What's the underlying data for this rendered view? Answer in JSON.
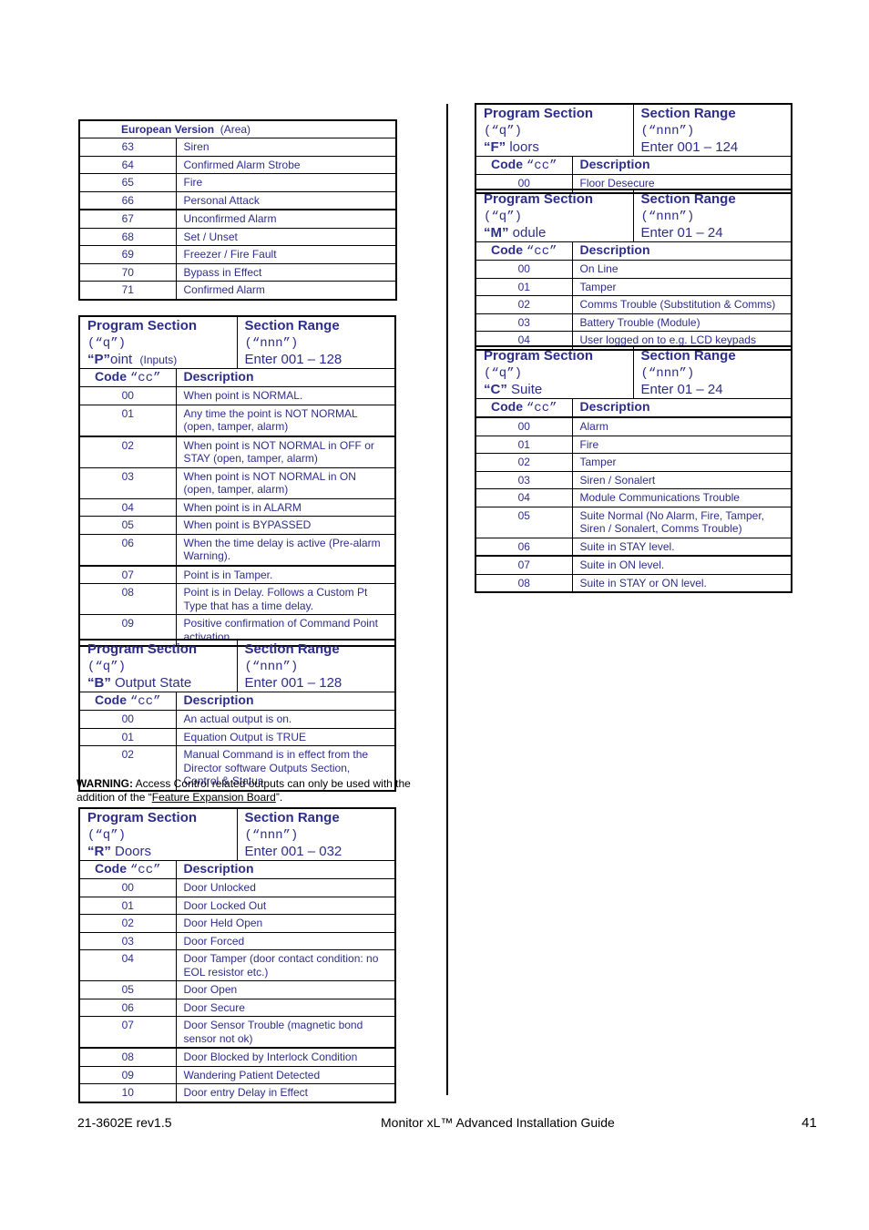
{
  "european": {
    "title_bold": "European Version",
    "title_rest": "(Area)",
    "rows": [
      {
        "code": "63",
        "desc": "Siren"
      },
      {
        "code": "64",
        "desc": "Confirmed Alarm Strobe"
      },
      {
        "code": "65",
        "desc": "Fire"
      },
      {
        "code": "66",
        "desc": "Personal Attack"
      },
      {
        "code": "67",
        "desc": "Unconfirmed Alarm"
      },
      {
        "code": "68",
        "desc": "Set / Unset"
      },
      {
        "code": "69",
        "desc": "Freezer / Fire Fault"
      },
      {
        "code": "70",
        "desc": "Bypass in Effect"
      },
      {
        "code": "71",
        "desc": "Confirmed Alarm"
      }
    ]
  },
  "common": {
    "program_section": "Program Section",
    "q_label": "(“q”)",
    "section_range": "Section Range",
    "nnn_label": "(“nnn”)",
    "code_label": "Code",
    "cc_label": "“cc”",
    "description_label": "Description"
  },
  "point": {
    "letter": "“P”",
    "name": "oint",
    "note": "(Inputs)",
    "range": "Enter 001 – 128",
    "rows": [
      {
        "code": "00",
        "desc": "When point is NORMAL."
      },
      {
        "code": "01",
        "desc": "Any time the point is NOT NORMAL (open, tamper, alarm)"
      },
      {
        "code": "02",
        "desc": "When point is NOT NORMAL in OFF or STAY (open, tamper, alarm)"
      },
      {
        "code": "03",
        "desc": "When point is NOT NORMAL in ON (open, tamper, alarm)"
      },
      {
        "code": "04",
        "desc": "When point is in ALARM"
      },
      {
        "code": "05",
        "desc": "When point is BYPASSED"
      },
      {
        "code": "06",
        "desc": "When the time delay is active (Pre-alarm Warning)."
      },
      {
        "code": "07",
        "desc": "Point is in Tamper."
      },
      {
        "code": "08",
        "desc": "Point is in Delay. Follows a Custom Pt Type that has a time delay."
      },
      {
        "code": "09",
        "desc": "Positive confirmation of Command Point activation."
      }
    ]
  },
  "output": {
    "letter": "“B”",
    "name": " Output State",
    "range": "Enter 001 – 128",
    "rows": [
      {
        "code": "00",
        "desc": "An actual output is on."
      },
      {
        "code": "01",
        "desc": "Equation Output is TRUE"
      },
      {
        "code": "02",
        "desc": "Manual Command is in effect from the Director software Outputs Section, Control & Status."
      }
    ]
  },
  "warning": {
    "label": "WARNING:",
    "text1": " Access Control related outputs can only be used with the addition of the “",
    "link": "Feature Expansion Board",
    "text2": "”."
  },
  "doors": {
    "letter": "“R”",
    "name": " Doors",
    "range": "Enter 001 – 032",
    "rows": [
      {
        "code": "00",
        "desc": "Door Unlocked"
      },
      {
        "code": "01",
        "desc": "Door Locked Out"
      },
      {
        "code": "02",
        "desc": "Door Held Open"
      },
      {
        "code": "03",
        "desc": "Door Forced"
      },
      {
        "code": "04",
        "desc": "Door Tamper (door contact condition: no EOL resistor etc.)"
      },
      {
        "code": "05",
        "desc": "Door Open"
      },
      {
        "code": "06",
        "desc": "Door Secure"
      },
      {
        "code": "07",
        "desc": "Door Sensor Trouble (magnetic bond sensor not ok)"
      },
      {
        "code": "08",
        "desc": "Door Blocked by Interlock Condition"
      },
      {
        "code": "09",
        "desc": "Wandering Patient Detected"
      },
      {
        "code": "10",
        "desc": "Door entry Delay in Effect"
      }
    ]
  },
  "floors": {
    "letter": "“F”",
    "name": " loors",
    "range": "Enter 001 – 124",
    "rows": [
      {
        "code": "00",
        "desc": "Floor Desecure"
      }
    ]
  },
  "module": {
    "letter": "“M”",
    "name": " odule",
    "range": "Enter 01 – 24",
    "rows": [
      {
        "code": "00",
        "desc": "On Line"
      },
      {
        "code": "01",
        "desc": "Tamper"
      },
      {
        "code": "02",
        "desc": "Comms Trouble (Substitution & Comms)"
      },
      {
        "code": "03",
        "desc": "Battery Trouble (Module)"
      },
      {
        "code": "04",
        "desc": "User logged on to e.g. LCD keypads"
      }
    ]
  },
  "suite": {
    "letter": "“C”",
    "name": " Suite",
    "range": "Enter 01 – 24",
    "rows": [
      {
        "code": "00",
        "desc": "Alarm"
      },
      {
        "code": "01",
        "desc": "Fire"
      },
      {
        "code": "02",
        "desc": "Tamper"
      },
      {
        "code": "03",
        "desc": "Siren / Sonalert"
      },
      {
        "code": "04",
        "desc": "Module Communications Trouble"
      },
      {
        "code": "05",
        "desc": "Suite Normal (No Alarm, Fire, Tamper, Siren / Sonalert, Comms Trouble)"
      },
      {
        "code": "06",
        "desc": "Suite in STAY level."
      },
      {
        "code": "07",
        "desc": "Suite in ON level."
      },
      {
        "code": "08",
        "desc": "Suite in STAY or ON level."
      }
    ]
  },
  "footer": {
    "doc_id": "21-3602E rev1.5",
    "title": "Monitor xL™ Advanced Installation Guide",
    "page": "41"
  }
}
